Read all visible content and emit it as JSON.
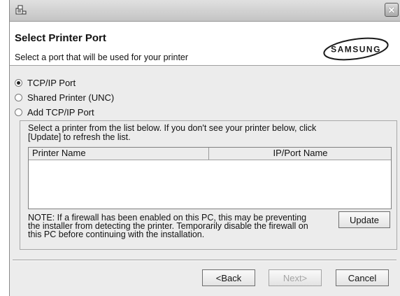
{
  "window": {
    "close_symbol": "✕"
  },
  "header": {
    "title": "Select Printer Port",
    "subtitle": "Select a port that will be used for your printer",
    "logo_text": "SAMSUNG"
  },
  "port_options": [
    {
      "label": "TCP/IP Port",
      "checked": true
    },
    {
      "label": "Shared Printer (UNC)",
      "checked": false
    },
    {
      "label": "Add TCP/IP Port",
      "checked": false
    }
  ],
  "printer_group": {
    "instruction_line1": "Select a printer from the list below. If you don't see your printer below, click",
    "instruction_line2": "[Update] to refresh the list.",
    "columns": [
      "Printer Name",
      "IP/Port Name"
    ],
    "rows": [],
    "note_line1": "NOTE: If a firewall has been enabled on this PC, this may be preventing",
    "note_line2": "the installer from detecting the printer. Temporarily disable the firewall on",
    "note_line3": "this PC before continuing with the installation.",
    "update_label": "Update"
  },
  "footer": {
    "back_label": "<Back",
    "next_label": "Next>",
    "next_enabled": false,
    "cancel_label": "Cancel"
  },
  "icons": {
    "app": "installer-icon",
    "close": "close-icon"
  },
  "colors": {
    "dialog_bg": "#ececec",
    "header_bg": "#ffffff",
    "disabled_text": "#a4a4a4",
    "logo_fill": "#ffffff",
    "logo_text": "#1a1a1a"
  }
}
